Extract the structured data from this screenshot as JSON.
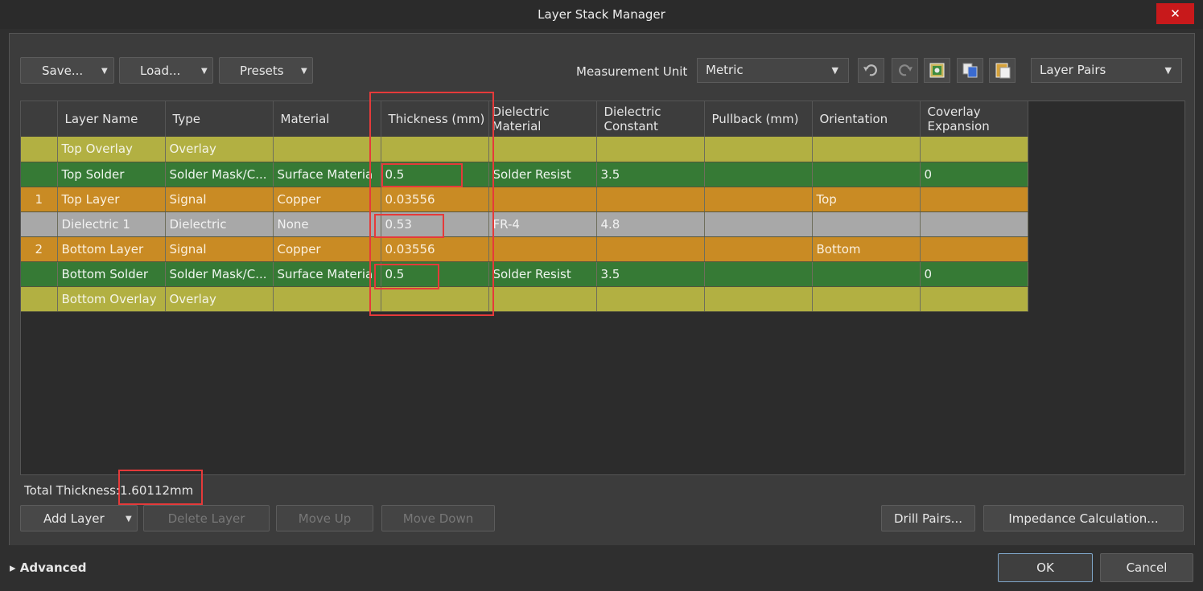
{
  "window": {
    "title": "Layer Stack Manager",
    "close_symbol": "✕"
  },
  "toolbar": {
    "save_label": "Save...",
    "load_label": "Load...",
    "presets_label": "Presets",
    "measurement_unit_label": "Measurement Unit",
    "measurement_unit_value": "Metric",
    "layer_pairs_value": "Layer Pairs",
    "icons": [
      "undo-icon",
      "redo-icon",
      "layer-stack-icon",
      "copy-icon",
      "paste-icon"
    ]
  },
  "table": {
    "columns": [
      "",
      "Layer Name",
      "Type",
      "Material",
      "Thickness (mm)",
      "Dielectric Material",
      "Dielectric Constant",
      "Pullback (mm)",
      "Orientation",
      "Coverlay Expansion"
    ],
    "column_lines": [
      [
        "",
        "Layer Name",
        "Type",
        "Material",
        "Thickness (mm)",
        "Dielectric",
        "Dielectric",
        "Pullback (mm)",
        "Orientation",
        "Coverlay"
      ],
      [
        "",
        "",
        "",
        "",
        "",
        "Material",
        "Constant",
        "",
        "",
        "Expansion"
      ]
    ],
    "rows": [
      {
        "kind": "overlay",
        "num": "",
        "name": "Top Overlay",
        "type": "Overlay",
        "material": "",
        "thickness": "",
        "diel_material": "",
        "diel_constant": "",
        "pullback": "",
        "orientation": "",
        "coverlay": ""
      },
      {
        "kind": "solder",
        "num": "",
        "name": "Top Solder",
        "type": "Solder Mask/C...",
        "material": "Surface Materia",
        "thickness": "0.5",
        "diel_material": "Solder Resist",
        "diel_constant": "3.5",
        "pullback": "",
        "orientation": "",
        "coverlay": "0"
      },
      {
        "kind": "signal",
        "num": "1",
        "name": "Top Layer",
        "type": "Signal",
        "material": "Copper",
        "thickness": "0.03556",
        "diel_material": "",
        "diel_constant": "",
        "pullback": "",
        "orientation": "Top",
        "coverlay": ""
      },
      {
        "kind": "dielectric",
        "num": "",
        "name": "Dielectric 1",
        "type": "Dielectric",
        "material": "None",
        "thickness": "0.53",
        "diel_material": "FR-4",
        "diel_constant": "4.8",
        "pullback": "",
        "orientation": "",
        "coverlay": ""
      },
      {
        "kind": "signal",
        "num": "2",
        "name": "Bottom Layer",
        "type": "Signal",
        "material": "Copper",
        "thickness": "0.03556",
        "diel_material": "",
        "diel_constant": "",
        "pullback": "",
        "orientation": "Bottom",
        "coverlay": ""
      },
      {
        "kind": "solder",
        "num": "",
        "name": "Bottom Solder",
        "type": "Solder Mask/C...",
        "material": "Surface Materia",
        "thickness": "0.5",
        "diel_material": "Solder Resist",
        "diel_constant": "3.5",
        "pullback": "",
        "orientation": "",
        "coverlay": "0"
      },
      {
        "kind": "overlay",
        "num": "",
        "name": "Bottom Overlay",
        "type": "Overlay",
        "material": "",
        "thickness": "",
        "diel_material": "",
        "diel_constant": "",
        "pullback": "",
        "orientation": "",
        "coverlay": ""
      }
    ]
  },
  "total": {
    "label": "Total Thickness:",
    "value": "1.60112mm"
  },
  "actions": {
    "add_layer": "Add Layer",
    "delete_layer": "Delete Layer",
    "move_up": "Move Up",
    "move_down": "Move Down",
    "drill_pairs": "Drill Pairs...",
    "impedance": "Impedance Calculation..."
  },
  "footer": {
    "advanced": "▸ Advanced",
    "ok": "OK",
    "cancel": "Cancel"
  },
  "colors": {
    "overlay": "#b2b042",
    "solder": "#367a35",
    "signal": "#c98b24",
    "dielectric": "#a8a8a8",
    "highlight": "#e53a3a",
    "close": "#c8191b"
  }
}
